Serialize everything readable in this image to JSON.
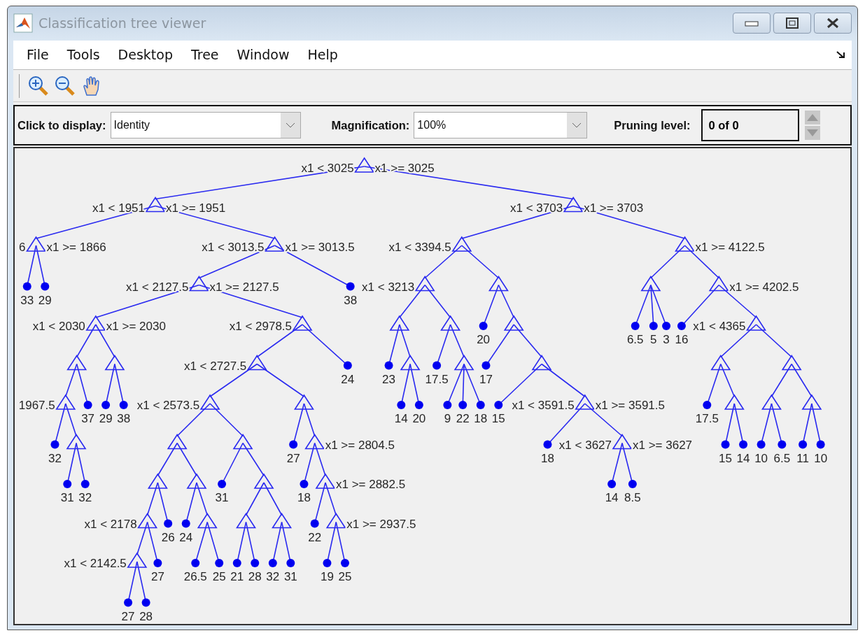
{
  "window": {
    "title": "Classification tree viewer"
  },
  "menu": [
    "File",
    "Tools",
    "Desktop",
    "Tree",
    "Window",
    "Help"
  ],
  "controls": {
    "display_label": "Click to display:",
    "display_value": "Identity",
    "magnification_label": "Magnification:",
    "magnification_value": "100%",
    "pruning_label": "Pruning level:",
    "pruning_value": "0 of 0"
  },
  "tree": {
    "kind": "split",
    "left_rule": "x1 < 3025",
    "right_rule": "x1 >= 3025",
    "children": [
      {
        "kind": "split",
        "left_rule": "x1 < 1951",
        "right_rule": "x1 >= 1951",
        "children": [
          {
            "kind": "split",
            "left_rule": "6",
            "right_rule": "x1 >= 1866",
            "children": [
              {
                "kind": "leaf",
                "value": "33"
              },
              {
                "kind": "leaf",
                "value": "29"
              }
            ]
          },
          {
            "kind": "split",
            "left_rule": "x1 < 3013.5",
            "right_rule": "x1 >= 3013.5",
            "children": [
              {
                "kind": "split",
                "left_rule": "x1 < 2127.5",
                "right_rule": "x1 >= 2127.5",
                "children": [
                  {
                    "kind": "split",
                    "left_rule": "x1 < 2030",
                    "right_rule": "x1 >= 2030",
                    "children": [
                      {
                        "kind": "split",
                        "children": [
                          {
                            "kind": "split",
                            "left_rule": "1967.5",
                            "children": [
                              {
                                "kind": "leaf",
                                "value": "32"
                              },
                              {
                                "kind": "split",
                                "children": [
                                  {
                                    "kind": "leaf",
                                    "value": "31"
                                  },
                                  {
                                    "kind": "leaf",
                                    "value": "32"
                                  }
                                ]
                              }
                            ]
                          },
                          {
                            "kind": "leaf",
                            "value": "37"
                          }
                        ]
                      },
                      {
                        "kind": "split",
                        "children": [
                          {
                            "kind": "leaf",
                            "value": "29"
                          },
                          {
                            "kind": "leaf",
                            "value": "38"
                          }
                        ]
                      }
                    ]
                  },
                  {
                    "kind": "split",
                    "left_rule": "x1 < 2978.5",
                    "children": [
                      {
                        "kind": "split",
                        "left_rule": "x1 < 2727.5",
                        "children": [
                          {
                            "kind": "split",
                            "left_rule": "x1 < 2573.5",
                            "children": [
                              {
                                "kind": "split",
                                "children": [
                                  {
                                    "kind": "split",
                                    "children": [
                                      {
                                        "kind": "split",
                                        "left_rule": "x1 < 2178",
                                        "children": [
                                          {
                                            "kind": "split",
                                            "left_rule": "x1 < 2142.5",
                                            "children": [
                                              {
                                                "kind": "leaf",
                                                "value": "27"
                                              },
                                              {
                                                "kind": "leaf",
                                                "value": "28"
                                              }
                                            ]
                                          },
                                          {
                                            "kind": "leaf",
                                            "value": "27"
                                          }
                                        ]
                                      },
                                      {
                                        "kind": "leaf",
                                        "value": "26"
                                      }
                                    ]
                                  },
                                  {
                                    "kind": "split",
                                    "children": [
                                      {
                                        "kind": "leaf",
                                        "value": "24"
                                      },
                                      {
                                        "kind": "split",
                                        "children": [
                                          {
                                            "kind": "leaf",
                                            "value": "26.5"
                                          },
                                          {
                                            "kind": "leaf",
                                            "value": "25"
                                          }
                                        ]
                                      }
                                    ]
                                  }
                                ]
                              },
                              {
                                "kind": "split",
                                "children": [
                                  {
                                    "kind": "leaf",
                                    "value": "31"
                                  },
                                  {
                                    "kind": "split",
                                    "children": [
                                      {
                                        "kind": "split",
                                        "children": [
                                          {
                                            "kind": "leaf",
                                            "value": "21"
                                          },
                                          {
                                            "kind": "leaf",
                                            "value": "28"
                                          }
                                        ]
                                      },
                                      {
                                        "kind": "split",
                                        "children": [
                                          {
                                            "kind": "leaf",
                                            "value": "32"
                                          },
                                          {
                                            "kind": "leaf",
                                            "value": "31"
                                          }
                                        ]
                                      }
                                    ]
                                  }
                                ]
                              }
                            ]
                          },
                          {
                            "kind": "split",
                            "children": [
                              {
                                "kind": "leaf",
                                "value": "27"
                              },
                              {
                                "kind": "split",
                                "right_rule": "x1 >= 2804.5",
                                "children": [
                                  {
                                    "kind": "leaf",
                                    "value": "18"
                                  },
                                  {
                                    "kind": "split",
                                    "right_rule": "x1 >= 2882.5",
                                    "children": [
                                      {
                                        "kind": "leaf",
                                        "value": "22"
                                      },
                                      {
                                        "kind": "split",
                                        "right_rule": "x1 >= 2937.5",
                                        "children": [
                                          {
                                            "kind": "leaf",
                                            "value": "19"
                                          },
                                          {
                                            "kind": "leaf",
                                            "value": "25"
                                          }
                                        ]
                                      }
                                    ]
                                  }
                                ]
                              }
                            ]
                          }
                        ]
                      },
                      {
                        "kind": "leaf",
                        "value": "24"
                      }
                    ]
                  }
                ]
              },
              {
                "kind": "leaf",
                "value": "38"
              }
            ]
          }
        ]
      },
      {
        "kind": "split",
        "left_rule": "x1 < 3703",
        "right_rule": "x1 >= 3703",
        "children": [
          {
            "kind": "split",
            "left_rule": "x1 < 3394.5",
            "children": [
              {
                "kind": "split",
                "left_rule": "x1 < 3213",
                "children": [
                  {
                    "kind": "split",
                    "children": [
                      {
                        "kind": "leaf",
                        "value": "23"
                      },
                      {
                        "kind": "split",
                        "children": [
                          {
                            "kind": "leaf",
                            "value": "14"
                          },
                          {
                            "kind": "leaf",
                            "value": "20"
                          }
                        ]
                      }
                    ]
                  },
                  {
                    "kind": "split",
                    "children": [
                      {
                        "kind": "leaf",
                        "value": "17.5"
                      },
                      {
                        "kind": "split",
                        "children": [
                          {
                            "kind": "leaf",
                            "value": "9"
                          },
                          {
                            "kind": "leaf",
                            "value": "22"
                          },
                          {
                            "kind": "leaf",
                            "value": "18"
                          }
                        ]
                      }
                    ]
                  }
                ]
              },
              {
                "kind": "split",
                "children": [
                  {
                    "kind": "leaf",
                    "value": "20"
                  },
                  {
                    "kind": "split",
                    "children": [
                      {
                        "kind": "leaf",
                        "value": "17"
                      },
                      {
                        "kind": "split",
                        "children": [
                          {
                            "kind": "leaf",
                            "value": "15"
                          },
                          {
                            "kind": "split",
                            "left_rule": "x1 < 3591.5",
                            "right_rule": "x1 >= 3591.5",
                            "children": [
                              {
                                "kind": "leaf",
                                "value": "18"
                              },
                              {
                                "kind": "split",
                                "left_rule": "x1 < 3627",
                                "right_rule": "x1 >= 3627",
                                "children": [
                                  {
                                    "kind": "leaf",
                                    "value": "14"
                                  },
                                  {
                                    "kind": "leaf",
                                    "value": "8.5"
                                  }
                                ]
                              }
                            ]
                          }
                        ]
                      }
                    ]
                  }
                ]
              }
            ]
          },
          {
            "kind": "split",
            "right_rule": "x1 >= 4122.5",
            "children": [
              {
                "kind": "split",
                "children": [
                  {
                    "kind": "leaf",
                    "value": "6.5"
                  },
                  {
                    "kind": "leaf",
                    "value": "5"
                  },
                  {
                    "kind": "leaf",
                    "value": "3"
                  }
                ]
              },
              {
                "kind": "split",
                "right_rule": "x1 >= 4202.5",
                "children": [
                  {
                    "kind": "leaf",
                    "value": "16"
                  },
                  {
                    "kind": "split",
                    "left_rule": "x1 < 4365",
                    "children": [
                      {
                        "kind": "split",
                        "children": [
                          {
                            "kind": "leaf",
                            "value": "17.5"
                          },
                          {
                            "kind": "split",
                            "children": [
                              {
                                "kind": "leaf",
                                "value": "15"
                              },
                              {
                                "kind": "leaf",
                                "value": "14"
                              }
                            ]
                          }
                        ]
                      },
                      {
                        "kind": "split",
                        "children": [
                          {
                            "kind": "split",
                            "children": [
                              {
                                "kind": "leaf",
                                "value": "10"
                              },
                              {
                                "kind": "leaf",
                                "value": "6.5"
                              }
                            ]
                          },
                          {
                            "kind": "split",
                            "children": [
                              {
                                "kind": "leaf",
                                "value": "11"
                              },
                              {
                                "kind": "leaf",
                                "value": "10"
                              }
                            ]
                          }
                        ]
                      }
                    ]
                  }
                ]
              }
            ]
          }
        ]
      }
    ]
  }
}
